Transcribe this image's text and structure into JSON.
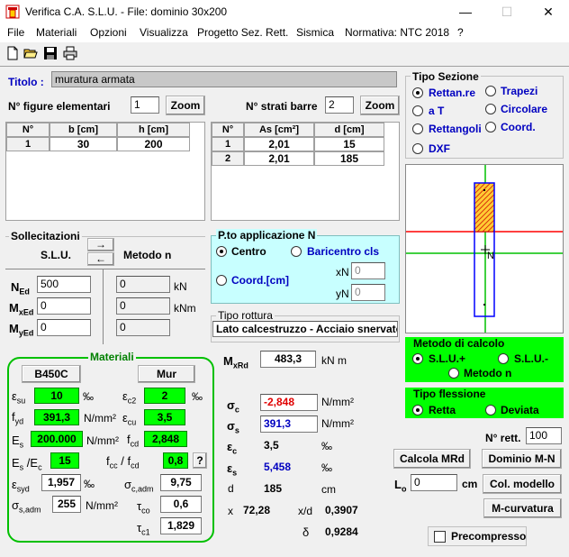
{
  "window": {
    "title": "Verifica C.A. S.L.U. - File: dominio 30x200"
  },
  "menu": [
    "File",
    "Materiali",
    "Opzioni",
    "Visualizza",
    "Progetto Sez. Rett.",
    "Sismica",
    "Normativa: NTC 2018",
    "?"
  ],
  "titolo": {
    "label": "Titolo :",
    "value": "muratura armata"
  },
  "figure": {
    "label": "N° figure elementari",
    "value": "1",
    "zoom": "Zoom"
  },
  "strati": {
    "label": "N° strati barre",
    "value": "2",
    "zoom": "Zoom"
  },
  "table_figure": {
    "headers": [
      "N°",
      "b [cm]",
      "h [cm]"
    ],
    "rows": [
      [
        "1",
        "30",
        "200"
      ]
    ]
  },
  "table_barre": {
    "headers": [
      "N°",
      "As [cm²]",
      "d [cm]"
    ],
    "rows": [
      [
        "1",
        "2,01",
        "15"
      ],
      [
        "2",
        "2,01",
        "185"
      ]
    ]
  },
  "tipo_sezione": {
    "title": "Tipo Sezione",
    "options": [
      "Rettan.re",
      "Trapezi",
      "a T",
      "Circolare",
      "Rettangoli",
      "Coord.",
      "DXF"
    ],
    "selected": "Rettan.re"
  },
  "sollecitazioni": {
    "title": "Sollecitazioni",
    "slu": "S.L.U.",
    "metodo_n": "Metodo n",
    "NEd": "500",
    "MxEd": "0",
    "MyEd": "0",
    "n_N": "0",
    "n_Mx": "0",
    "n_My": "0",
    "unit_kN": "kN",
    "unit_kNm": "kNm"
  },
  "pto_applicazione": {
    "title": "P.to applicazione N",
    "centro": "Centro",
    "baricentro": "Baricentro cls",
    "coord": "Coord.[cm]",
    "xN": "0",
    "yN": "0",
    "xN_label": "xN",
    "yN_label": "yN"
  },
  "tipo_rottura": {
    "title": "Tipo rottura",
    "value": "Lato calcestruzzo - Acciaio snervato"
  },
  "materiali": {
    "title": "Materiali",
    "steel": "B450C",
    "concrete": "Mur",
    "esu": "10",
    "esu_unit": "‰",
    "ec2": "2",
    "ec2_unit": "‰",
    "fyd": "391,3",
    "fyd_unit": "N/mm²",
    "ecu": "3,5",
    "Es": "200.000",
    "Es_unit": "N/mm²",
    "fcd": "2,848",
    "Es_Ec": "15",
    "fcc_fcd": "0,8",
    "help": "?",
    "esyd": "1,957",
    "esyd_unit": "‰",
    "sc_adm": "9,75",
    "ss_adm": "255",
    "ss_adm_unit": "N/mm²",
    "tco": "0,6",
    "tc1": "1,829"
  },
  "risultati": {
    "MxRd": "483,3",
    "MxRd_unit": "kN m",
    "sc": "-2,848",
    "sc_unit": "N/mm²",
    "ss": "391,3",
    "ss_unit": "N/mm²",
    "ec": "3,5",
    "ec_unit": "‰",
    "es": "5,458",
    "es_unit": "‰",
    "d": "185",
    "d_unit": "cm",
    "x_label": "x",
    "x": "72,28",
    "xd_label": "x/d",
    "xd": "0,3907",
    "delta": "0,9284"
  },
  "metodo_calcolo": {
    "title": "Metodo di calcolo",
    "options": [
      "S.L.U.+",
      "S.L.U.-",
      "Metodo n"
    ],
    "selected": "S.L.U.+"
  },
  "tipo_flessione": {
    "title": "Tipo flessione",
    "options": [
      "Retta",
      "Deviata"
    ],
    "selected": "Retta"
  },
  "nrett": {
    "label": "N° rett.",
    "value": "100"
  },
  "buttons": {
    "calcola": "Calcola MRd",
    "dominio": "Dominio M-N",
    "col_modello": "Col. modello",
    "mcurvatura": "M-curvatura"
  },
  "lo": {
    "label": "Lo",
    "value": "0",
    "unit": "cm"
  },
  "precompresso": {
    "label": "Precompresso",
    "checked": false
  },
  "diagram": {
    "N_label": "N"
  }
}
